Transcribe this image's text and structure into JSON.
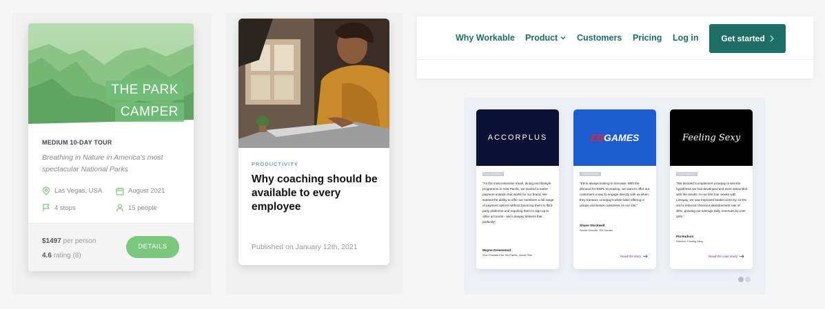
{
  "tour_card": {
    "badge_line1": "THE PARK",
    "badge_line2": "CAMPER",
    "type": "MEDIUM 10-DAY TOUR",
    "subtitle": "Breathing in Nature in America's most spectacular National Parks",
    "location": "Las Vegas, USA",
    "date": "August 2021",
    "stops": "4 stops",
    "people": "15 people",
    "price_value": "$1497",
    "price_unit": "per person",
    "rating_value": "4.6",
    "rating_suffix": "rating (8)",
    "details_button": "DETAILS",
    "icons": {
      "location": "map-pin-icon",
      "date": "calendar-icon",
      "stops": "flag-icon",
      "people": "user-icon"
    },
    "accent_color": "#7bc77d"
  },
  "article_card": {
    "category": "PRODUCTIVITY",
    "title": "Why coaching should be available to every employee",
    "published": "Published on January 12th, 2021"
  },
  "nav": {
    "items": [
      "Why Workable",
      "Product",
      "Customers",
      "Pricing",
      "Log in"
    ],
    "cta_label": "Get started",
    "brand_color": "#1e6e65"
  },
  "testimonials": {
    "cards": [
      {
        "logo": "ACCORPLUS",
        "tag": "CUSTOMERS",
        "quote": "\"As the most extensive travel, dining and lifestyle programme in Asia Pacific, we wanted a native payment solution that works for our brand. We wanted the ability to offer our members a full range of payment options without bouncing them to third party platforms and requiring them to sign up to other accounts - and Limepay delivers that perfectly\".",
        "author": "Wayne Greenwood",
        "role": "Vice President for the Pacific, Accor Plus",
        "link": ""
      },
      {
        "logo_part1": "EB",
        "logo_part2": "GAMES",
        "tag": "CUSTOMERS",
        "quote": "\"EB is always looking to innovate. With the demand for BNPL increasing, we want to offer our customers a way to engage directly with us when they transact. Limepay's white-label offering is unique and keeps customers on our site.\"",
        "author": "Shane Stockwell",
        "role": "Senior Director, EB Games",
        "link": "Read the story"
      },
      {
        "logo": "Feeling Sexy",
        "tag": "CUSTOMERS",
        "quote": "\"We decided to implement Limepay to test the hypothesis we had developed and were astounded with the results. In our first four weeks with Limepay, we saw improved basket sizes by 12.5% and a reduced checkout abandonment rate of 30%, growing our average daily revenues by over 18%.\"",
        "author": "Pia Hudson",
        "role": "Director, Feeling Sexy",
        "link": "Read the case study"
      }
    ]
  }
}
